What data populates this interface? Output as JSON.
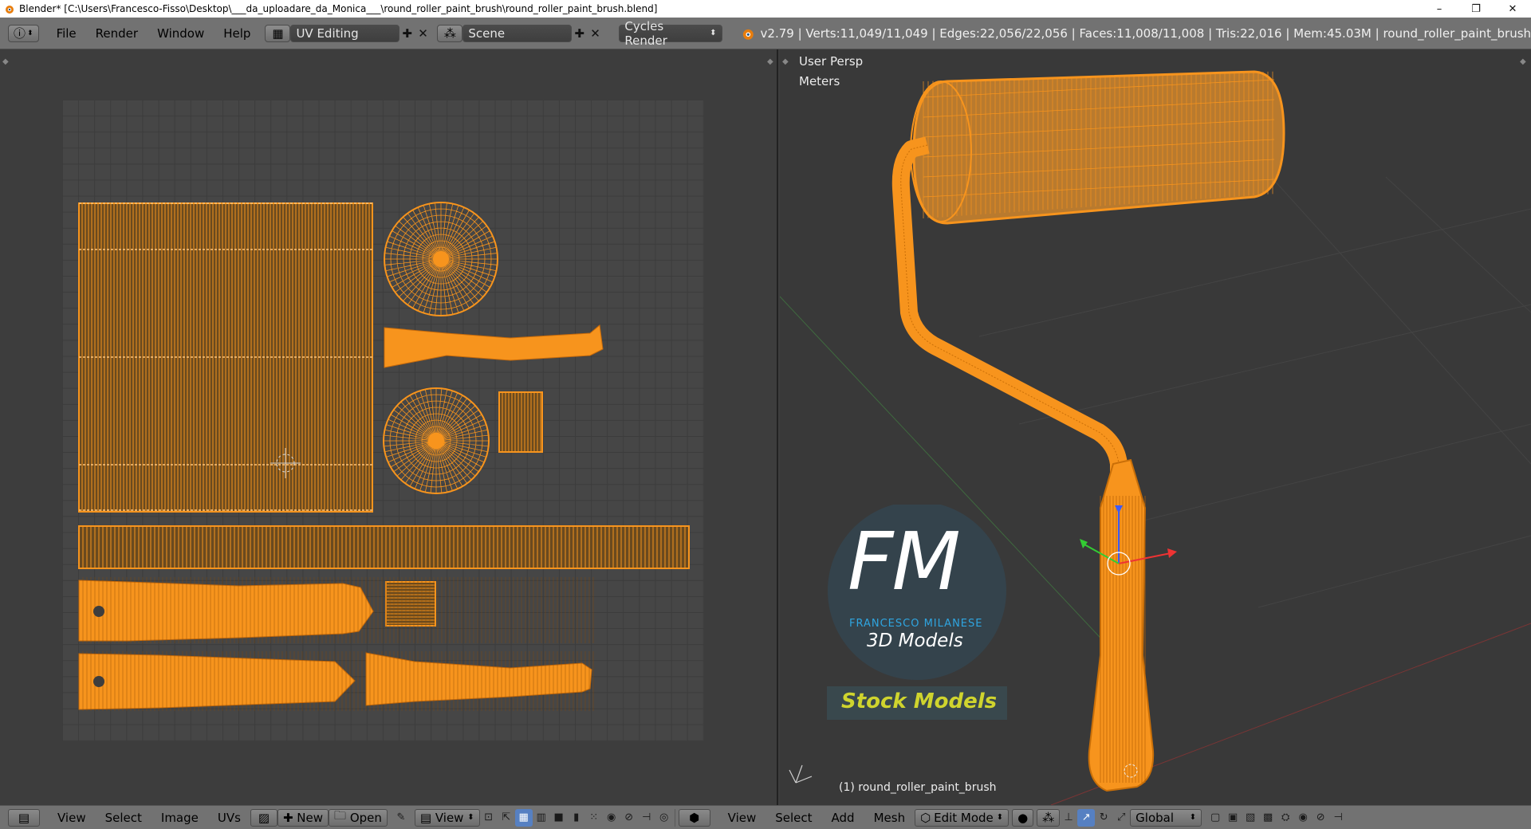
{
  "window": {
    "title": "Blender* [C:\\Users\\Francesco-Fisso\\Desktop\\___da_uploadare_da_Monica___\\round_roller_paint_brush\\round_roller_paint_brush.blend]",
    "minimize": "–",
    "maximize": "❐",
    "close": "✕"
  },
  "topbar": {
    "menus": [
      "File",
      "Render",
      "Window",
      "Help"
    ],
    "screen_layout": "UV Editing",
    "scene": "Scene",
    "render_engine": "Cycles Render",
    "stats": "v2.79 | Verts:11,049/11,049 | Edges:22,056/22,056 | Faces:11,008/11,008 | Tris:22,016 | Mem:45.03M | round_roller_paint_brush"
  },
  "viewport": {
    "view_name": "User Persp",
    "units": "Meters",
    "object_label": "(1) round_roller_paint_brush"
  },
  "watermark": {
    "initials": "FM",
    "author": "FRANCESCO MILANESE",
    "subtitle": "3D Models",
    "tag": "Stock Models"
  },
  "uv_editor_bar": {
    "menus": [
      "View",
      "Select",
      "Image",
      "UVs"
    ],
    "new_label": "New",
    "open_label": "Open",
    "view_label": "View"
  },
  "view3d_bar": {
    "menus": [
      "View",
      "Select",
      "Add",
      "Mesh"
    ],
    "mode": "Edit Mode",
    "orientation": "Global"
  },
  "colors": {
    "mesh": "#f7941d",
    "accent": "#5680c2"
  }
}
